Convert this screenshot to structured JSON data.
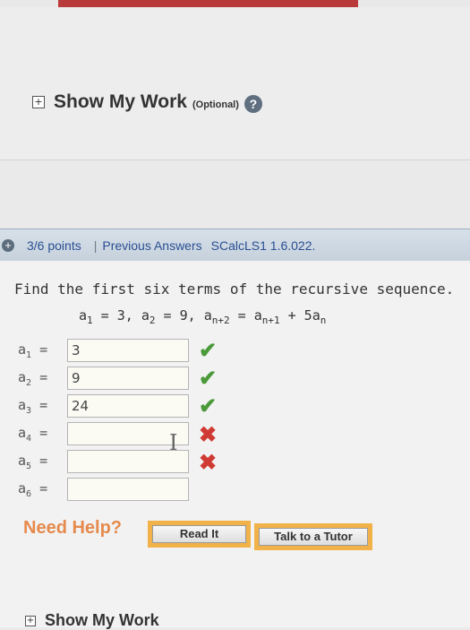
{
  "show_my_work": {
    "title": "Show My Work",
    "optional": "(Optional)",
    "help": "?"
  },
  "question_header": {
    "expand_icon": "+",
    "points": "3/6 points",
    "separator": "|",
    "previous_answers": "Previous Answers",
    "problem_code": "SCalcLS1 1.6.022."
  },
  "question": {
    "prompt": "Find the first six terms of the recursive sequence.",
    "formula": {
      "a1": "a",
      "a1_sub": "1",
      "a1_rhs": " = 3, ",
      "a2": "a",
      "a2_sub": "2",
      "a2_rhs": " = 9, ",
      "an2": "a",
      "an2_sub": "n+2",
      "eq": " = ",
      "an1": "a",
      "an1_sub": "n+1",
      "plus": " + 5",
      "an": "a",
      "an_sub": "n"
    }
  },
  "answers": [
    {
      "var": "a",
      "sub": "1",
      "eq": " =",
      "value": "3",
      "status": "correct"
    },
    {
      "var": "a",
      "sub": "2",
      "eq": " =",
      "value": "9",
      "status": "correct"
    },
    {
      "var": "a",
      "sub": "3",
      "eq": " =",
      "value": "24",
      "status": "correct"
    },
    {
      "var": "a",
      "sub": "4",
      "eq": " =",
      "value": "",
      "status": "incorrect"
    },
    {
      "var": "a",
      "sub": "5",
      "eq": " =",
      "value": "",
      "status": "incorrect"
    },
    {
      "var": "a",
      "sub": "6",
      "eq": " =",
      "value": "",
      "status": "none"
    }
  ],
  "marks": {
    "correct": "✔",
    "incorrect": "✖"
  },
  "cursor_glyph": "I",
  "help": {
    "need_help": "Need Help?",
    "read_it": "Read It",
    "talk_to_tutor": "Talk to a Tutor"
  },
  "bottom": {
    "label": "Show My Work"
  },
  "colors": {
    "header_bar": "#c9d4df",
    "link_blue": "#2a4f93",
    "correct_green": "#4a9a3a",
    "incorrect_red": "#d03a34",
    "need_help_orange": "#e58a4c",
    "button_border": "#f1b24a"
  }
}
